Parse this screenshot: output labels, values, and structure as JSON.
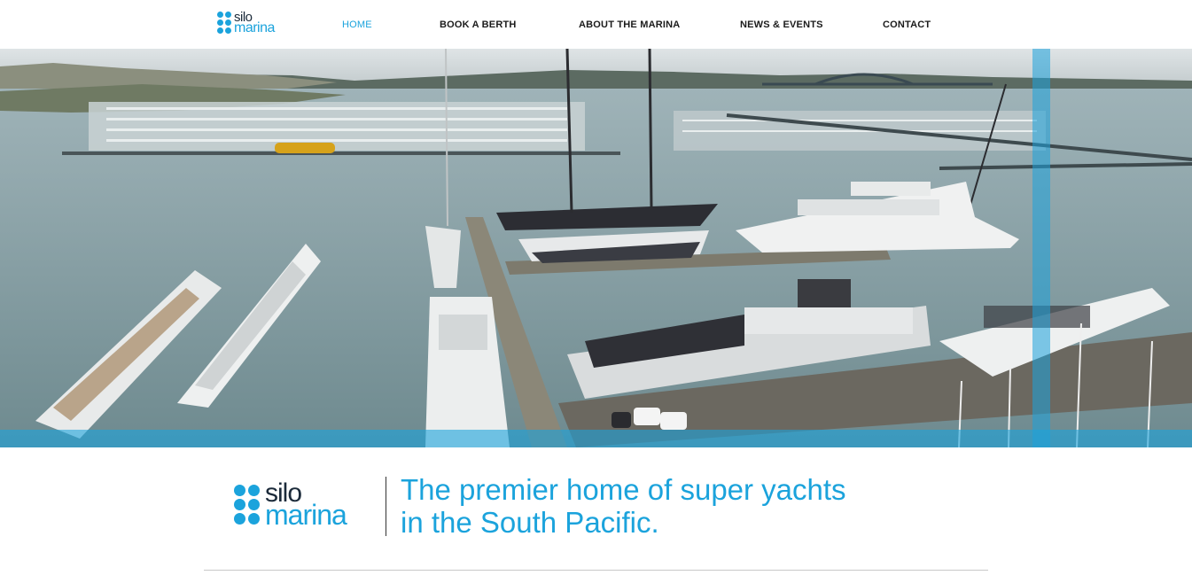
{
  "brand": {
    "word1": "silo",
    "word2": "marina",
    "accent_color": "#1ba3dc",
    "dark_color": "#1b2a3a"
  },
  "nav": {
    "items": [
      {
        "label": "HOME",
        "active": true
      },
      {
        "label": "BOOK A BERTH",
        "active": false
      },
      {
        "label": "ABOUT THE MARINA",
        "active": false
      },
      {
        "label": "NEWS & EVENTS",
        "active": false
      },
      {
        "label": "CONTACT",
        "active": false
      }
    ]
  },
  "hero": {
    "image_subject": "aerial-marina-superyachts-photo"
  },
  "tagline": {
    "line1": "The premier home of super yachts",
    "line2": "in the South Pacific."
  }
}
